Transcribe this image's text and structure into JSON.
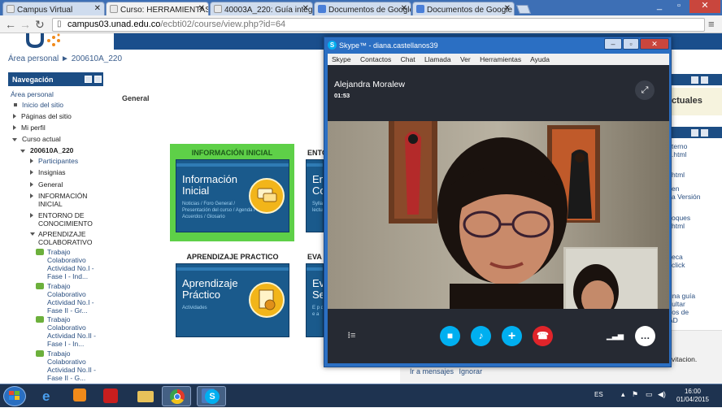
{
  "browser": {
    "tabs": [
      {
        "label": "Campus Virtual",
        "icon": "moodle-icon",
        "active": false
      },
      {
        "label": "Curso: HERRAMIENTAS DI",
        "icon": "moodle-icon",
        "active": true
      },
      {
        "label": "40003A_220: Guía integra",
        "icon": "moodle-icon",
        "active": false
      },
      {
        "label": "Documentos de Google: c",
        "icon": "google-docs-icon",
        "active": false
      },
      {
        "label": "Documentos de Google",
        "icon": "google-docs-icon",
        "active": false
      }
    ],
    "url_host": "campus03.unad.edu.co",
    "url_path": "/ecbti02/course/view.php?id=64"
  },
  "page": {
    "breadcrumb": "Área personal ► 200610A_220",
    "nav_title": "Navegación",
    "nav_items": [
      {
        "label": "Área personal"
      },
      {
        "label": "Inicio del sitio"
      },
      {
        "label": "Páginas del sitio"
      },
      {
        "label": "Mi perfil"
      },
      {
        "label": "Curso actual"
      },
      {
        "label": "200610A_220"
      },
      {
        "label": "Participantes"
      },
      {
        "label": "Insignias"
      },
      {
        "label": "General"
      },
      {
        "label": "INFORMACIÓN INICIAL"
      },
      {
        "label": "ENTORNO DE CONOCIMIENTO"
      },
      {
        "label": "APRENDIZAJE COLABORATIVO"
      },
      {
        "label": "Trabajo Colaborativo Actividad No.I - Fase I - Ind..."
      },
      {
        "label": "Trabajo Colaborativo Actividad No.I - Fase II - Gr..."
      },
      {
        "label": "Trabajo Colaborativo Actividad No.II - Fase I - In..."
      },
      {
        "label": "Trabajo Colaborativo Actividad No.II - Fase II - G..."
      }
    ],
    "section_general": "General",
    "cards": [
      {
        "header": "INFORMACIÓN INICIAL",
        "title_line1": "Información",
        "title_line2": "Inicial",
        "subtitle": "Noticias / Foro General / Presentación del curso / Agenda / Acuerdos / Glosario"
      },
      {
        "header": "ENTO",
        "title_line1": "Ent",
        "title_line2": "Co",
        "subtitle": "Sylla lectu"
      },
      {
        "header": "APRENDIZAJE PRACTICO",
        "title_line1": "Aprendizaje",
        "title_line2": "Práctico",
        "subtitle": "Actividades"
      },
      {
        "header": "EVA",
        "title_line1": "Eva",
        "title_line2": "Se",
        "subtitle": "E p d e a"
      }
    ],
    "right_fragments": [
      "ctuales",
      "terno",
      ".html",
      "html",
      "en",
      "a Versión",
      "oques",
      "html",
      "eca",
      "click",
      "una guía",
      "sultar",
      "vos de",
      "AD",
      "vitacion."
    ],
    "notice_links": [
      "Ir a mensajes",
      "Ignorar"
    ]
  },
  "skype": {
    "window_title": "Skype™ - diana.castellanos39",
    "menu": [
      "Skype",
      "Contactos",
      "Chat",
      "Llamada",
      "Ver",
      "Herramientas",
      "Ayuda"
    ],
    "contact_name": "Alejandra Moralew",
    "call_duration": "01:53"
  },
  "taskbar": {
    "language": "ES",
    "time": "16:00",
    "date": "01/04/2015",
    "apps": [
      "start-button",
      "internet-explorer-icon",
      "media-player-icon",
      "zynga-icon",
      "file-explorer-icon",
      "chrome-icon",
      "word-icon",
      "skype-icon"
    ]
  },
  "colors": {
    "brand_blue": "#1c4d84",
    "skype_blue": "#00aff0",
    "end_call_red": "#e0242a",
    "info_highlight": "#5ed048"
  }
}
